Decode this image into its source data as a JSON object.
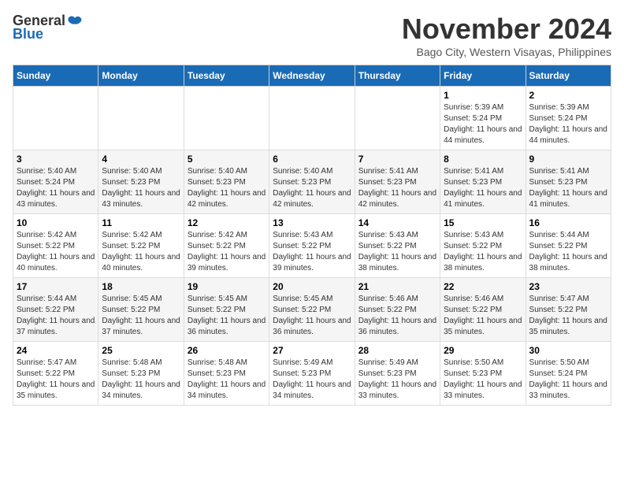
{
  "logo": {
    "general": "General",
    "blue": "Blue"
  },
  "title": "November 2024",
  "location": "Bago City, Western Visayas, Philippines",
  "weekdays": [
    "Sunday",
    "Monday",
    "Tuesday",
    "Wednesday",
    "Thursday",
    "Friday",
    "Saturday"
  ],
  "weeks": [
    [
      {
        "day": "",
        "sunrise": "",
        "sunset": "",
        "daylight": ""
      },
      {
        "day": "",
        "sunrise": "",
        "sunset": "",
        "daylight": ""
      },
      {
        "day": "",
        "sunrise": "",
        "sunset": "",
        "daylight": ""
      },
      {
        "day": "",
        "sunrise": "",
        "sunset": "",
        "daylight": ""
      },
      {
        "day": "",
        "sunrise": "",
        "sunset": "",
        "daylight": ""
      },
      {
        "day": "1",
        "sunrise": "Sunrise: 5:39 AM",
        "sunset": "Sunset: 5:24 PM",
        "daylight": "Daylight: 11 hours and 44 minutes."
      },
      {
        "day": "2",
        "sunrise": "Sunrise: 5:39 AM",
        "sunset": "Sunset: 5:24 PM",
        "daylight": "Daylight: 11 hours and 44 minutes."
      }
    ],
    [
      {
        "day": "3",
        "sunrise": "Sunrise: 5:40 AM",
        "sunset": "Sunset: 5:24 PM",
        "daylight": "Daylight: 11 hours and 43 minutes."
      },
      {
        "day": "4",
        "sunrise": "Sunrise: 5:40 AM",
        "sunset": "Sunset: 5:23 PM",
        "daylight": "Daylight: 11 hours and 43 minutes."
      },
      {
        "day": "5",
        "sunrise": "Sunrise: 5:40 AM",
        "sunset": "Sunset: 5:23 PM",
        "daylight": "Daylight: 11 hours and 42 minutes."
      },
      {
        "day": "6",
        "sunrise": "Sunrise: 5:40 AM",
        "sunset": "Sunset: 5:23 PM",
        "daylight": "Daylight: 11 hours and 42 minutes."
      },
      {
        "day": "7",
        "sunrise": "Sunrise: 5:41 AM",
        "sunset": "Sunset: 5:23 PM",
        "daylight": "Daylight: 11 hours and 42 minutes."
      },
      {
        "day": "8",
        "sunrise": "Sunrise: 5:41 AM",
        "sunset": "Sunset: 5:23 PM",
        "daylight": "Daylight: 11 hours and 41 minutes."
      },
      {
        "day": "9",
        "sunrise": "Sunrise: 5:41 AM",
        "sunset": "Sunset: 5:23 PM",
        "daylight": "Daylight: 11 hours and 41 minutes."
      }
    ],
    [
      {
        "day": "10",
        "sunrise": "Sunrise: 5:42 AM",
        "sunset": "Sunset: 5:22 PM",
        "daylight": "Daylight: 11 hours and 40 minutes."
      },
      {
        "day": "11",
        "sunrise": "Sunrise: 5:42 AM",
        "sunset": "Sunset: 5:22 PM",
        "daylight": "Daylight: 11 hours and 40 minutes."
      },
      {
        "day": "12",
        "sunrise": "Sunrise: 5:42 AM",
        "sunset": "Sunset: 5:22 PM",
        "daylight": "Daylight: 11 hours and 39 minutes."
      },
      {
        "day": "13",
        "sunrise": "Sunrise: 5:43 AM",
        "sunset": "Sunset: 5:22 PM",
        "daylight": "Daylight: 11 hours and 39 minutes."
      },
      {
        "day": "14",
        "sunrise": "Sunrise: 5:43 AM",
        "sunset": "Sunset: 5:22 PM",
        "daylight": "Daylight: 11 hours and 38 minutes."
      },
      {
        "day": "15",
        "sunrise": "Sunrise: 5:43 AM",
        "sunset": "Sunset: 5:22 PM",
        "daylight": "Daylight: 11 hours and 38 minutes."
      },
      {
        "day": "16",
        "sunrise": "Sunrise: 5:44 AM",
        "sunset": "Sunset: 5:22 PM",
        "daylight": "Daylight: 11 hours and 38 minutes."
      }
    ],
    [
      {
        "day": "17",
        "sunrise": "Sunrise: 5:44 AM",
        "sunset": "Sunset: 5:22 PM",
        "daylight": "Daylight: 11 hours and 37 minutes."
      },
      {
        "day": "18",
        "sunrise": "Sunrise: 5:45 AM",
        "sunset": "Sunset: 5:22 PM",
        "daylight": "Daylight: 11 hours and 37 minutes."
      },
      {
        "day": "19",
        "sunrise": "Sunrise: 5:45 AM",
        "sunset": "Sunset: 5:22 PM",
        "daylight": "Daylight: 11 hours and 36 minutes."
      },
      {
        "day": "20",
        "sunrise": "Sunrise: 5:45 AM",
        "sunset": "Sunset: 5:22 PM",
        "daylight": "Daylight: 11 hours and 36 minutes."
      },
      {
        "day": "21",
        "sunrise": "Sunrise: 5:46 AM",
        "sunset": "Sunset: 5:22 PM",
        "daylight": "Daylight: 11 hours and 36 minutes."
      },
      {
        "day": "22",
        "sunrise": "Sunrise: 5:46 AM",
        "sunset": "Sunset: 5:22 PM",
        "daylight": "Daylight: 11 hours and 35 minutes."
      },
      {
        "day": "23",
        "sunrise": "Sunrise: 5:47 AM",
        "sunset": "Sunset: 5:22 PM",
        "daylight": "Daylight: 11 hours and 35 minutes."
      }
    ],
    [
      {
        "day": "24",
        "sunrise": "Sunrise: 5:47 AM",
        "sunset": "Sunset: 5:22 PM",
        "daylight": "Daylight: 11 hours and 35 minutes."
      },
      {
        "day": "25",
        "sunrise": "Sunrise: 5:48 AM",
        "sunset": "Sunset: 5:23 PM",
        "daylight": "Daylight: 11 hours and 34 minutes."
      },
      {
        "day": "26",
        "sunrise": "Sunrise: 5:48 AM",
        "sunset": "Sunset: 5:23 PM",
        "daylight": "Daylight: 11 hours and 34 minutes."
      },
      {
        "day": "27",
        "sunrise": "Sunrise: 5:49 AM",
        "sunset": "Sunset: 5:23 PM",
        "daylight": "Daylight: 11 hours and 34 minutes."
      },
      {
        "day": "28",
        "sunrise": "Sunrise: 5:49 AM",
        "sunset": "Sunset: 5:23 PM",
        "daylight": "Daylight: 11 hours and 33 minutes."
      },
      {
        "day": "29",
        "sunrise": "Sunrise: 5:50 AM",
        "sunset": "Sunset: 5:23 PM",
        "daylight": "Daylight: 11 hours and 33 minutes."
      },
      {
        "day": "30",
        "sunrise": "Sunrise: 5:50 AM",
        "sunset": "Sunset: 5:24 PM",
        "daylight": "Daylight: 11 hours and 33 minutes."
      }
    ]
  ]
}
